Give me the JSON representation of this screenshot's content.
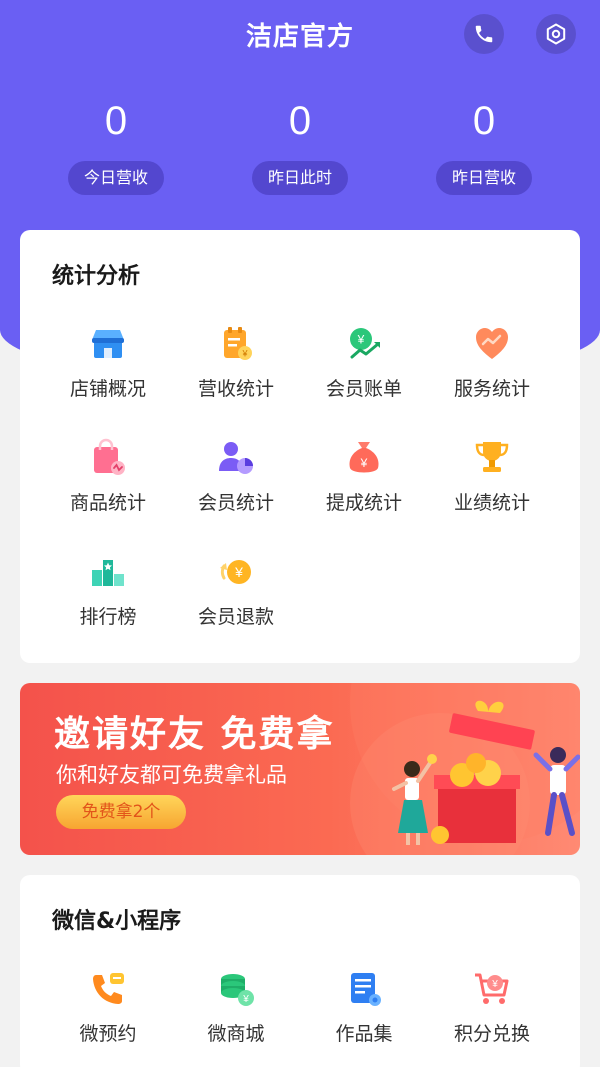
{
  "header": {
    "title": "洁店官方"
  },
  "stats": [
    {
      "value": "0",
      "label": "今日营收"
    },
    {
      "value": "0",
      "label": "昨日此时"
    },
    {
      "value": "0",
      "label": "昨日营收"
    }
  ],
  "analysis": {
    "title": "统计分析",
    "items": [
      {
        "label": "店铺概况",
        "icon": "store-icon"
      },
      {
        "label": "营收统计",
        "icon": "revenue-report-icon"
      },
      {
        "label": "会员账单",
        "icon": "member-bill-icon"
      },
      {
        "label": "服务统计",
        "icon": "heart-chart-icon"
      },
      {
        "label": "商品统计",
        "icon": "shopping-bag-icon"
      },
      {
        "label": "会员统计",
        "icon": "member-pie-icon"
      },
      {
        "label": "提成统计",
        "icon": "money-bag-icon"
      },
      {
        "label": "业绩统计",
        "icon": "trophy-icon"
      },
      {
        "label": "排行榜",
        "icon": "ranking-icon"
      },
      {
        "label": "会员退款",
        "icon": "refund-icon"
      }
    ]
  },
  "banner": {
    "title": "邀请好友  免费拿",
    "subtitle": "你和好友都可免费拿礼品",
    "button": "免费拿2个"
  },
  "wechat": {
    "title": "微信&小程序",
    "items": [
      {
        "label": "微预约",
        "icon": "phone-booking-icon"
      },
      {
        "label": "微商城",
        "icon": "coin-stack-icon"
      },
      {
        "label": "作品集",
        "icon": "portfolio-icon"
      },
      {
        "label": "积分兑换",
        "icon": "points-cart-icon"
      }
    ]
  },
  "colors": {
    "primary": "#6a5ff3",
    "banner": "#f4524b"
  }
}
